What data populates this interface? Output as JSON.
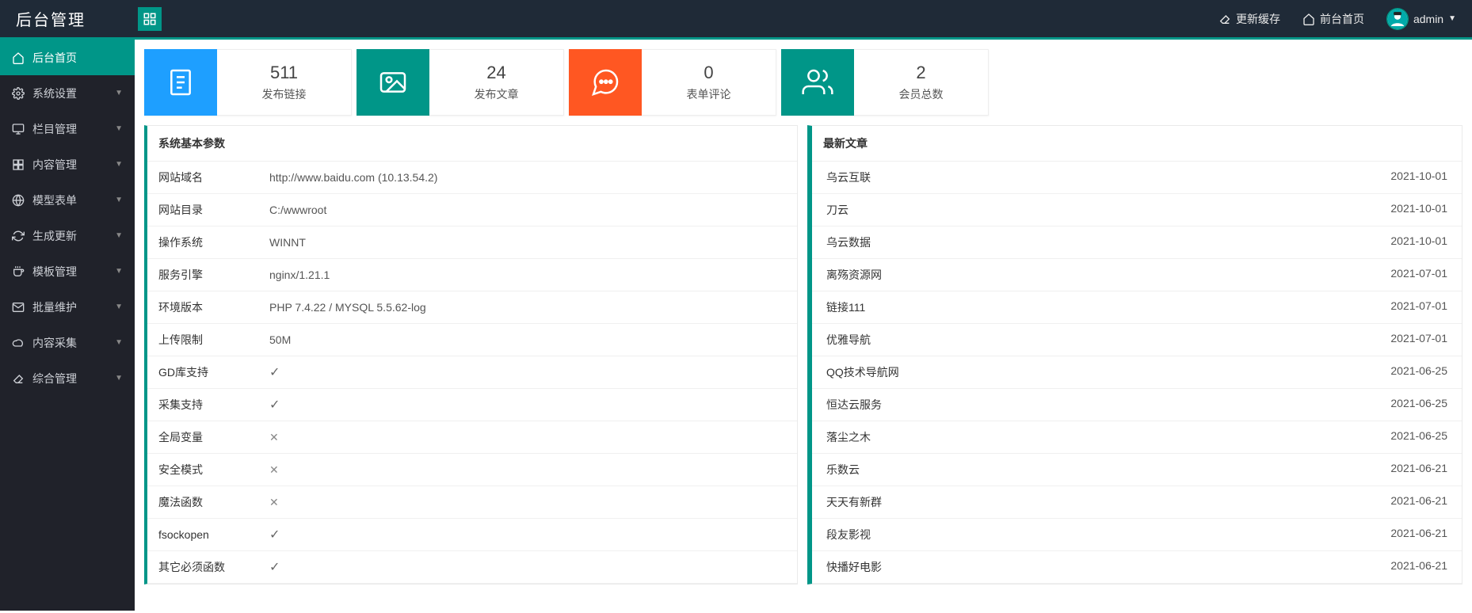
{
  "header": {
    "logo": "后台管理",
    "refresh_cache": "更新缓存",
    "front_home": "前台首页",
    "username": "admin"
  },
  "sidebar": [
    {
      "icon": "home",
      "label": "后台首页",
      "active": true,
      "expandable": false
    },
    {
      "icon": "gear",
      "label": "系统设置",
      "active": false,
      "expandable": true
    },
    {
      "icon": "monitor",
      "label": "栏目管理",
      "active": false,
      "expandable": true
    },
    {
      "icon": "layers",
      "label": "内容管理",
      "active": false,
      "expandable": true
    },
    {
      "icon": "globe",
      "label": "模型表单",
      "active": false,
      "expandable": true
    },
    {
      "icon": "refresh",
      "label": "生成更新",
      "active": false,
      "expandable": true
    },
    {
      "icon": "cup",
      "label": "模板管理",
      "active": false,
      "expandable": true
    },
    {
      "icon": "mail",
      "label": "批量维护",
      "active": false,
      "expandable": true
    },
    {
      "icon": "cloud",
      "label": "内容采集",
      "active": false,
      "expandable": true
    },
    {
      "icon": "eraser",
      "label": "综合管理",
      "active": false,
      "expandable": true
    }
  ],
  "stats": [
    {
      "color": "bg-blue",
      "icon": "doc",
      "num": "511",
      "label": "发布链接"
    },
    {
      "color": "bg-teal",
      "icon": "image",
      "num": "24",
      "label": "发布文章"
    },
    {
      "color": "bg-orange",
      "icon": "chat",
      "num": "0",
      "label": "表单评论"
    },
    {
      "color": "bg-teal2",
      "icon": "users",
      "num": "2",
      "label": "会员总数"
    }
  ],
  "params_panel": {
    "title": "系统基本参数",
    "rows": [
      {
        "k": "网站域名",
        "v": "http://www.baidu.com (10.13.54.2)",
        "t": "text"
      },
      {
        "k": "网站目录",
        "v": "C:/wwwroot",
        "t": "text"
      },
      {
        "k": "操作系统",
        "v": "WINNT",
        "t": "text"
      },
      {
        "k": "服务引擎",
        "v": "nginx/1.21.1",
        "t": "text"
      },
      {
        "k": "环境版本",
        "v": "PHP 7.4.22 / MYSQL 5.5.62-log",
        "t": "text"
      },
      {
        "k": "上传限制",
        "v": "50M",
        "t": "text"
      },
      {
        "k": "GD库支持",
        "v": "",
        "t": "check"
      },
      {
        "k": "采集支持",
        "v": "",
        "t": "check"
      },
      {
        "k": "全局变量",
        "v": "",
        "t": "x"
      },
      {
        "k": "安全模式",
        "v": "",
        "t": "x"
      },
      {
        "k": "魔法函数",
        "v": "",
        "t": "x"
      },
      {
        "k": "fsockopen",
        "v": "",
        "t": "check"
      },
      {
        "k": "其它必须函数",
        "v": "",
        "t": "check"
      }
    ]
  },
  "latest_panel": {
    "title": "最新文章",
    "rows": [
      {
        "title": "乌云互联",
        "date": "2021-10-01"
      },
      {
        "title": "刀云",
        "date": "2021-10-01"
      },
      {
        "title": "乌云数据",
        "date": "2021-10-01"
      },
      {
        "title": "离殇资源网",
        "date": "2021-07-01"
      },
      {
        "title": "链接111",
        "date": "2021-07-01"
      },
      {
        "title": "优雅导航",
        "date": "2021-07-01"
      },
      {
        "title": "QQ技术导航网",
        "date": "2021-06-25"
      },
      {
        "title": "恒达云服务",
        "date": "2021-06-25"
      },
      {
        "title": "落尘之木",
        "date": "2021-06-25"
      },
      {
        "title": "乐数云",
        "date": "2021-06-21"
      },
      {
        "title": "天天有新群",
        "date": "2021-06-21"
      },
      {
        "title": "段友影视",
        "date": "2021-06-21"
      },
      {
        "title": "快播好电影",
        "date": "2021-06-21"
      }
    ]
  }
}
